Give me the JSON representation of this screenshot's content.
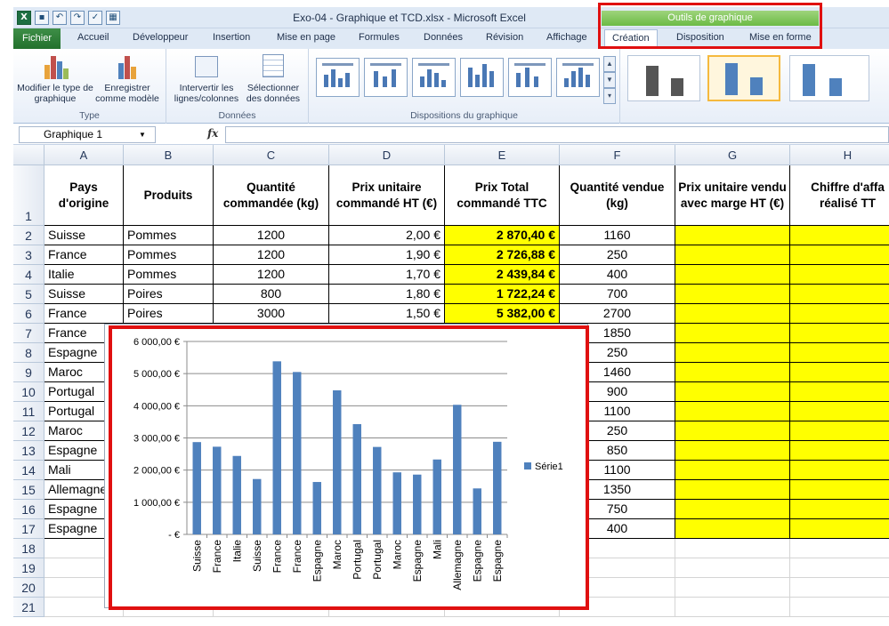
{
  "window": {
    "title": "Exo-04 - Graphique et TCD.xlsx - Microsoft Excel",
    "contextual_group": "Outils de graphique"
  },
  "tabs": [
    {
      "label": "Fichier",
      "key": "file"
    },
    {
      "label": "Accueil"
    },
    {
      "label": "Développeur"
    },
    {
      "label": "Insertion"
    },
    {
      "label": "Mise en page"
    },
    {
      "label": "Formules"
    },
    {
      "label": "Données"
    },
    {
      "label": "Révision"
    },
    {
      "label": "Affichage"
    },
    {
      "label": "Création",
      "active": true
    },
    {
      "label": "Disposition"
    },
    {
      "label": "Mise en forme"
    }
  ],
  "ribbon": {
    "type_group": {
      "title": "Type",
      "change_type": "Modifier le type de graphique",
      "save_template": "Enregistrer comme modèle"
    },
    "data_group": {
      "title": "Données",
      "switch_rowcol": "Intervertir les lignes/colonnes",
      "select_data": "Sélectionner des données"
    },
    "layouts_group": {
      "title": "Dispositions du graphique"
    }
  },
  "formula_bar": {
    "name_box": "Graphique 1",
    "fx": "fx",
    "value": ""
  },
  "columns": [
    "A",
    "B",
    "C",
    "D",
    "E",
    "F",
    "G",
    "H"
  ],
  "rows": [
    "1",
    "2",
    "3",
    "4",
    "5",
    "6",
    "7",
    "8",
    "9",
    "10",
    "11",
    "12",
    "13",
    "14",
    "15",
    "16",
    "17",
    "18",
    "19",
    "20",
    "21"
  ],
  "headers": {
    "A": "Pays d'origine",
    "B": "Produits",
    "C": "Quantité commandée (kg)",
    "D": "Prix unitaire commandé HT (€)",
    "E": "Prix Total commandé TTC",
    "F": "Quantité vendue (kg)",
    "G": "Prix unitaire vendu avec marge HT (€)",
    "H": "Chiffre d'affa réalisé TT"
  },
  "table": [
    {
      "country": "Suisse",
      "product": "Pommes",
      "qty": "1200",
      "unit_price": "2,00 €",
      "total": "2 870,40 €",
      "sold": "1160"
    },
    {
      "country": "France",
      "product": "Pommes",
      "qty": "1200",
      "unit_price": "1,90 €",
      "total": "2 726,88 €",
      "sold": "250"
    },
    {
      "country": "Italie",
      "product": "Pommes",
      "qty": "1200",
      "unit_price": "1,70 €",
      "total": "2 439,84 €",
      "sold": "400"
    },
    {
      "country": "Suisse",
      "product": "Poires",
      "qty": "800",
      "unit_price": "1,80 €",
      "total": "1 722,24 €",
      "sold": "700"
    },
    {
      "country": "France",
      "product": "Poires",
      "qty": "3000",
      "unit_price": "1,50 €",
      "total": "5 382,00 €",
      "sold": "2700"
    },
    {
      "country": "France",
      "product": "",
      "qty": "",
      "unit_price": "",
      "total": "",
      "sold": "1850"
    },
    {
      "country": "Espagne",
      "product": "",
      "qty": "",
      "unit_price": "",
      "total": "",
      "sold": "250"
    },
    {
      "country": "Maroc",
      "product": "",
      "qty": "",
      "unit_price": "",
      "total": "",
      "sold": "1460"
    },
    {
      "country": "Portugal",
      "product": "",
      "qty": "",
      "unit_price": "",
      "total": "",
      "sold": "900"
    },
    {
      "country": "Portugal",
      "product": "",
      "qty": "",
      "unit_price": "",
      "total": "",
      "sold": "1100"
    },
    {
      "country": "Maroc",
      "product": "",
      "qty": "",
      "unit_price": "",
      "total": "",
      "sold": "250"
    },
    {
      "country": "Espagne",
      "product": "",
      "qty": "",
      "unit_price": "",
      "total": "",
      "sold": "850"
    },
    {
      "country": "Mali",
      "product": "",
      "qty": "",
      "unit_price": "",
      "total": "",
      "sold": "1100"
    },
    {
      "country": "Allemagne",
      "product": "",
      "qty": "",
      "unit_price": "",
      "total": "",
      "sold": "1350"
    },
    {
      "country": "Espagne",
      "product": "",
      "qty": "",
      "unit_price": "",
      "total": "",
      "sold": "750"
    },
    {
      "country": "Espagne",
      "product": "",
      "qty": "",
      "unit_price": "",
      "total": "",
      "sold": "400"
    }
  ],
  "colors": {
    "highlight_yellow": "#FFFF00",
    "bar_blue": "#4F81BD",
    "callout_red": "#E01010",
    "excel_green": "#23712D"
  },
  "chart_data": {
    "type": "bar",
    "categories": [
      "Suisse",
      "France",
      "Italie",
      "Suisse",
      "France",
      "France",
      "Espagne",
      "Maroc",
      "Portugal",
      "Portugal",
      "Maroc",
      "Espagne",
      "Mali",
      "Allemagne",
      "Espagne",
      "Espagne"
    ],
    "series": [
      {
        "name": "Série1",
        "values": [
          2870.4,
          2726.88,
          2439.84,
          1722.24,
          5382.0,
          5050,
          1630,
          4480,
          3430,
          2720,
          1930,
          1860,
          2330,
          4030,
          1430,
          2880
        ]
      }
    ],
    "yticks": [
      "-   €",
      "1 000,00 €",
      "2 000,00 €",
      "3 000,00 €",
      "4 000,00 €",
      "5 000,00 €",
      "6 000,00 €"
    ],
    "ylim": [
      0,
      6000
    ],
    "grid": true,
    "legend": "right"
  }
}
